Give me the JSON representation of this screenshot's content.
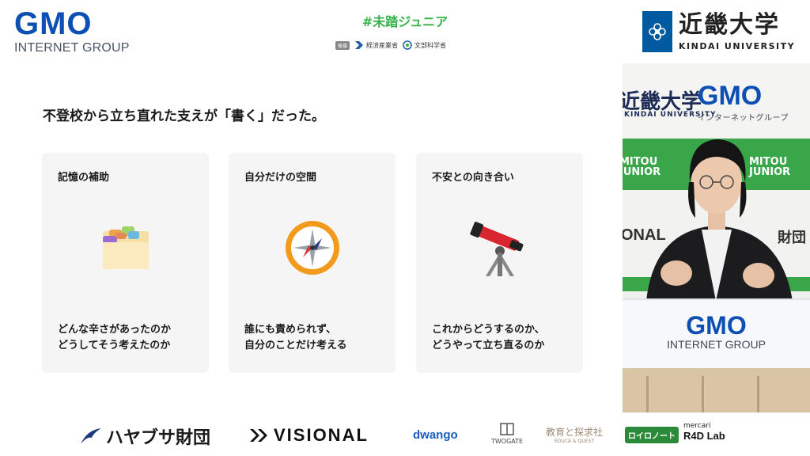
{
  "header": {
    "gmo": {
      "word": "GMO",
      "sub": "INTERNET GROUP"
    },
    "hashtag": "#未踏ジュニア",
    "sponsors": {
      "tag": "後援",
      "items": [
        {
          "label": "経済産業省",
          "icon": "meti-icon"
        },
        {
          "label": "文部科学省",
          "icon": "mext-icon"
        }
      ]
    },
    "kindai": {
      "title": "近畿大学",
      "sub": "KINDAI UNIVERSITY"
    }
  },
  "slide": {
    "title": "不登校から立ち直れた支えが「書く」だった。",
    "cards": [
      {
        "heading": "記憶の補助",
        "icon": "folder-icon",
        "line1": "どんな辛さがあったのか",
        "line2": "どうしてそう考えたのか"
      },
      {
        "heading": "自分だけの空間",
        "icon": "compass-icon",
        "line1": "誰にも責められず、",
        "line2": "自分のことだけ考える"
      },
      {
        "heading": "不安との向き合い",
        "icon": "telescope-icon",
        "line1": "これからどうするのか、",
        "line2": "どうやって立ち直るのか"
      }
    ]
  },
  "camera": {
    "backdrop": {
      "uni": "近畿大学",
      "uni_sub": "KINDAI UNIVERSITY",
      "gmo": "GMO",
      "gmo_sub": "インターネットグループ",
      "mitou": "MITOU",
      "junior": "JUNIOR",
      "visional": "ONAL",
      "foundation": "財団"
    },
    "podium": {
      "gmo": "GMO",
      "sub": "INTERNET GROUP"
    }
  },
  "bottom": {
    "hayabusa": "ハヤブサ財団",
    "visional": "VISIONAL",
    "dwango": "dwango",
    "twogate": "TWOGATE",
    "kyoiku": "教育と探求社",
    "kyoiku_sub": "EDUCA & QUEST",
    "roboto": "ロイロノート",
    "mercari": "mercari",
    "r4d": "R4D Lab"
  },
  "colors": {
    "gmo_blue": "#0d4fb3",
    "mitou_green": "#35b34a",
    "kindai_blue": "#005aa0"
  }
}
